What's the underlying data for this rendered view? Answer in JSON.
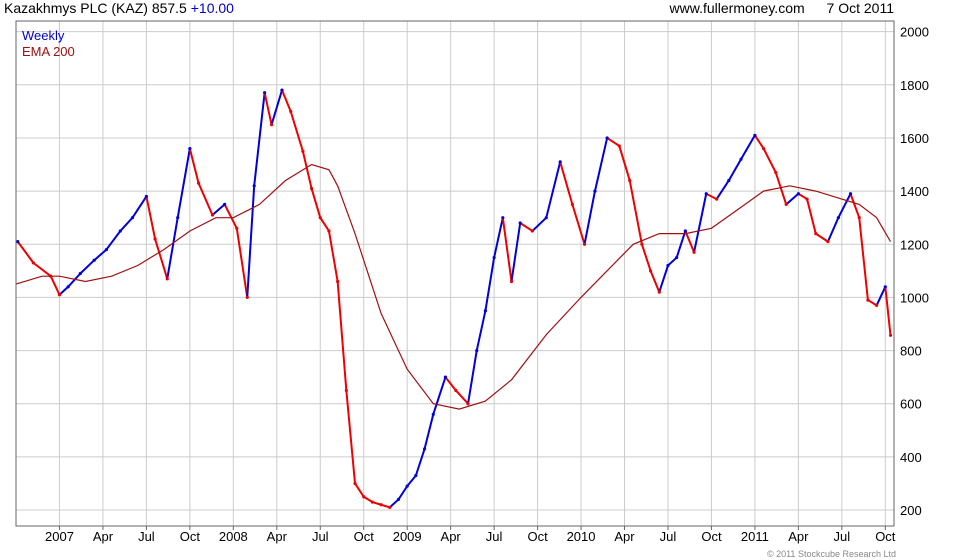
{
  "header": {
    "title": "Kazakhmys PLC (KAZ) 857.5",
    "change": "+10.00",
    "site": "www.fullermoney.com",
    "date": "7 Oct 2011"
  },
  "legend": {
    "series1": "Weekly",
    "series2": "EMA 200"
  },
  "copyright": "© 2011 Stockcube Research Ltd",
  "colors": {
    "up": "#0000dd",
    "down": "#ee0000",
    "ema": "#a01010",
    "grid": "#cccccc"
  },
  "chart_data": {
    "type": "line",
    "grid": true,
    "legend_position": "top-left",
    "ylim": [
      140,
      2040
    ],
    "yticks": [
      200,
      400,
      600,
      800,
      1000,
      1200,
      1400,
      1600,
      1800,
      2000
    ],
    "xtick_labels": [
      "2007",
      "Apr",
      "Jul",
      "Oct",
      "2008",
      "Apr",
      "Jul",
      "Oct",
      "2009",
      "Apr",
      "Jul",
      "Oct",
      "2010",
      "Apr",
      "Jul",
      "Oct",
      "2011",
      "Apr",
      "Jul",
      "Oct"
    ],
    "x_range_years": [
      2006.75,
      2011.8
    ],
    "series": [
      {
        "name": "Weekly",
        "x": [
          2006.76,
          2006.85,
          2006.95,
          2007.0,
          2007.05,
          2007.12,
          2007.2,
          2007.27,
          2007.35,
          2007.42,
          2007.5,
          2007.55,
          2007.62,
          2007.68,
          2007.75,
          2007.8,
          2007.88,
          2007.95,
          2008.02,
          2008.08,
          2008.12,
          2008.18,
          2008.22,
          2008.28,
          2008.33,
          2008.4,
          2008.45,
          2008.5,
          2008.55,
          2008.6,
          2008.65,
          2008.7,
          2008.75,
          2008.8,
          2008.85,
          2008.9,
          2008.95,
          2009.0,
          2009.05,
          2009.1,
          2009.15,
          2009.22,
          2009.28,
          2009.35,
          2009.4,
          2009.45,
          2009.5,
          2009.55,
          2009.6,
          2009.65,
          2009.72,
          2009.8,
          2009.88,
          2009.95,
          2010.02,
          2010.08,
          2010.15,
          2010.22,
          2010.28,
          2010.35,
          2010.4,
          2010.45,
          2010.5,
          2010.55,
          2010.6,
          2010.65,
          2010.72,
          2010.78,
          2010.85,
          2010.92,
          2011.0,
          2011.05,
          2011.12,
          2011.18,
          2011.25,
          2011.3,
          2011.35,
          2011.42,
          2011.48,
          2011.55,
          2011.6,
          2011.65,
          2011.7,
          2011.75,
          2011.78
        ],
        "values": [
          1210,
          1130,
          1080,
          1010,
          1040,
          1090,
          1140,
          1180,
          1250,
          1300,
          1380,
          1220,
          1070,
          1300,
          1560,
          1430,
          1310,
          1350,
          1260,
          1000,
          1420,
          1770,
          1650,
          1780,
          1700,
          1550,
          1410,
          1300,
          1250,
          1060,
          650,
          300,
          250,
          230,
          220,
          210,
          240,
          290,
          330,
          430,
          560,
          700,
          650,
          600,
          800,
          950,
          1150,
          1300,
          1060,
          1280,
          1250,
          1300,
          1510,
          1350,
          1200,
          1400,
          1600,
          1570,
          1440,
          1200,
          1100,
          1020,
          1120,
          1150,
          1250,
          1170,
          1390,
          1370,
          1440,
          1520,
          1610,
          1560,
          1470,
          1350,
          1390,
          1370,
          1240,
          1210,
          1300,
          1390,
          1300,
          990,
          970,
          1040,
          857.5
        ]
      },
      {
        "name": "EMA 200",
        "x": [
          2006.75,
          2006.9,
          2007.0,
          2007.15,
          2007.3,
          2007.45,
          2007.6,
          2007.75,
          2007.9,
          2008.0,
          2008.15,
          2008.3,
          2008.45,
          2008.55,
          2008.6,
          2008.7,
          2008.85,
          2009.0,
          2009.15,
          2009.3,
          2009.45,
          2009.6,
          2009.8,
          2010.0,
          2010.15,
          2010.3,
          2010.45,
          2010.6,
          2010.75,
          2010.9,
          2011.05,
          2011.2,
          2011.35,
          2011.5,
          2011.6,
          2011.7,
          2011.78
        ],
        "values": [
          1050,
          1080,
          1080,
          1060,
          1080,
          1120,
          1180,
          1250,
          1300,
          1300,
          1350,
          1440,
          1500,
          1480,
          1420,
          1240,
          940,
          730,
          600,
          580,
          610,
          690,
          860,
          1000,
          1100,
          1200,
          1240,
          1240,
          1260,
          1330,
          1400,
          1420,
          1400,
          1370,
          1350,
          1300,
          1210
        ]
      }
    ]
  }
}
